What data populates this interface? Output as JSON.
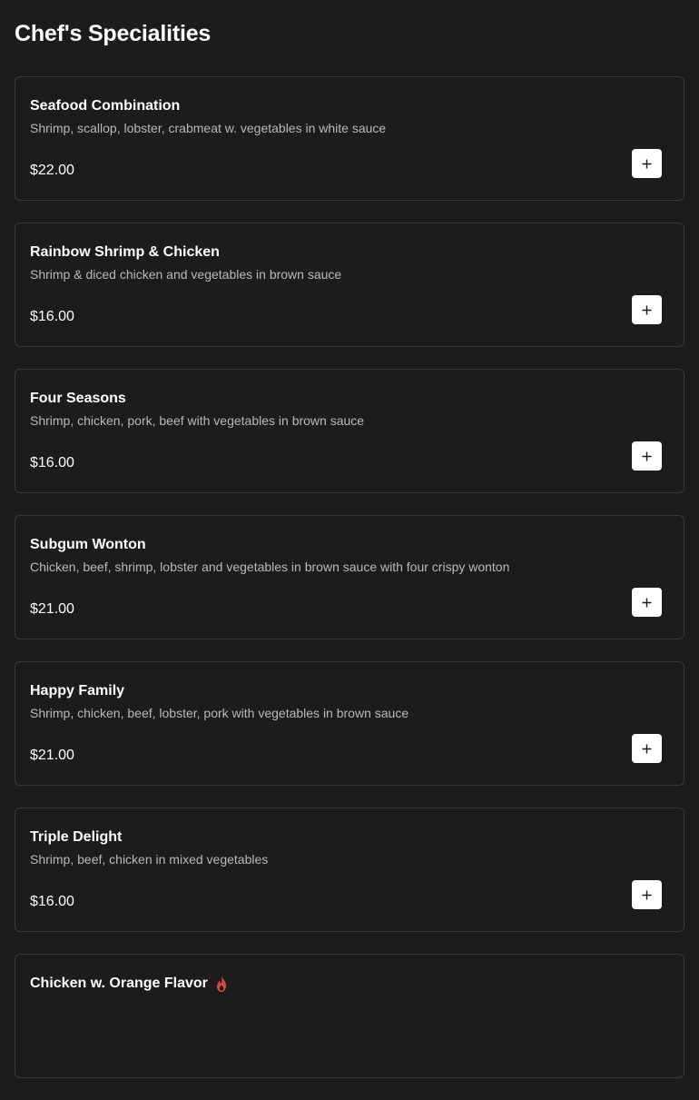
{
  "section": {
    "title": "Chef's Specialities"
  },
  "items": [
    {
      "name": "Seafood Combination",
      "description": "Shrimp, scallop, lobster, crabmeat w. vegetables in white sauce",
      "price": "$22.00",
      "spicy": false
    },
    {
      "name": "Rainbow Shrimp & Chicken",
      "description": "Shrimp & diced chicken and vegetables in brown sauce",
      "price": "$16.00",
      "spicy": false
    },
    {
      "name": "Four Seasons",
      "description": "Shrimp, chicken, pork, beef with vegetables in brown sauce",
      "price": "$16.00",
      "spicy": false
    },
    {
      "name": "Subgum Wonton",
      "description": "Chicken, beef, shrimp, lobster and vegetables in brown sauce with four crispy wonton",
      "price": "$21.00",
      "spicy": false
    },
    {
      "name": "Happy Family",
      "description": "Shrimp, chicken, beef, lobster, pork with vegetables in brown sauce",
      "price": "$21.00",
      "spicy": false
    },
    {
      "name": "Triple Delight",
      "description": "Shrimp, beef, chicken in mixed vegetables",
      "price": "$16.00",
      "spicy": false
    },
    {
      "name": "Chicken w. Orange Flavor",
      "description": "",
      "price": "",
      "spicy": true
    }
  ],
  "icons": {
    "add": "plus-icon",
    "spicy": "flame-icon"
  },
  "colors": {
    "background": "#1c1c1c",
    "card_border": "#3a3a3a",
    "description": "#b9b9b9",
    "button_bg": "#ffffff",
    "spicy": "#e0453a"
  }
}
